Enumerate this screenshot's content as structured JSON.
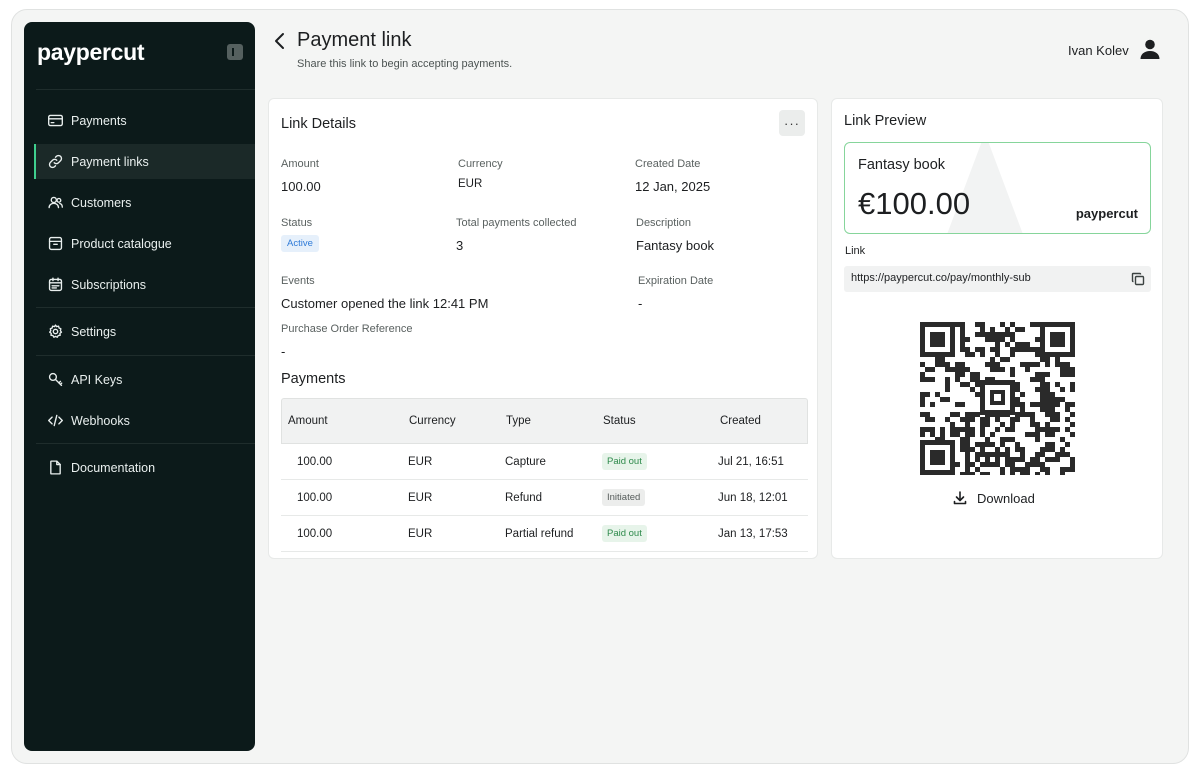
{
  "sidebar": {
    "logo": "paypercut",
    "items": [
      {
        "label": "Payments",
        "icon": "card-icon"
      },
      {
        "label": "Payment links",
        "icon": "link-icon",
        "active": true
      },
      {
        "label": "Customers",
        "icon": "users-icon"
      },
      {
        "label": "Product catalogue",
        "icon": "box-icon"
      },
      {
        "label": "Subscriptions",
        "icon": "calendar-icon"
      },
      {
        "label": "Settings",
        "icon": "gear-icon"
      },
      {
        "label": "API Keys",
        "icon": "key-icon"
      },
      {
        "label": "Webhooks",
        "icon": "code-icon"
      },
      {
        "label": "Documentation",
        "icon": "document-icon"
      }
    ]
  },
  "header": {
    "title": "Payment link",
    "subtitle": "Share this link to begin accepting payments.",
    "user_name": "Ivan Kolev"
  },
  "details": {
    "title": "Link Details",
    "more_label": "···",
    "amount_label": "Amount",
    "amount_value": "100.00",
    "currency_label": "Currency",
    "currency_value": "EUR",
    "created_label": "Created Date",
    "created_value": "12 Jan, 2025",
    "status_label": "Status",
    "status_value": "Active",
    "total_label": "Total payments collected",
    "total_value": "3",
    "description_label": "Description",
    "description_value": "Fantasy book",
    "events_label": "Events",
    "events_value": "Customer opened the link 12:41 PM",
    "expiration_label": "Expiration Date",
    "expiration_value": "-",
    "po_label": "Purchase Order Reference",
    "po_value": "-"
  },
  "payments": {
    "title": "Payments",
    "columns": [
      "Amount",
      "Currency",
      "Type",
      "Status",
      "Created"
    ],
    "rows": [
      {
        "amount": "100.00",
        "currency": "EUR",
        "type": "Capture",
        "status": "Paid out",
        "created": "Jul 21, 16:51"
      },
      {
        "amount": "100.00",
        "currency": "EUR",
        "type": "Refund",
        "status": "Initiated",
        "created": "Jun 18, 12:01"
      },
      {
        "amount": "100.00",
        "currency": "EUR",
        "type": "Partial refund",
        "status": "Paid out",
        "created": "Jan 13, 17:53"
      }
    ]
  },
  "preview": {
    "title": "Link Preview",
    "product_name": "Fantasy book",
    "amount": "€100.00",
    "brand": "paypercut",
    "link_label": "Link",
    "link_url": "https://paypercut.co/pay/monthly-sub",
    "download_label": "Download"
  },
  "colors": {
    "sidebar_bg": "#0c1a1a",
    "accent_green": "#3fcf8e",
    "preview_border": "#86d59b",
    "paid_badge": "#2e8a4b",
    "active_badge": "#2f7bd8"
  }
}
